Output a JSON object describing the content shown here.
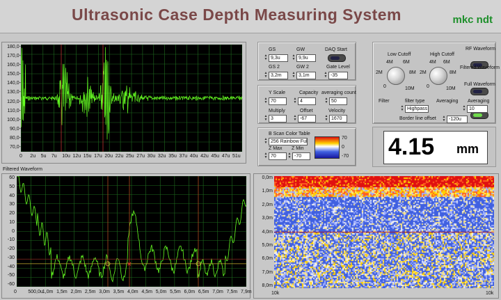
{
  "title": "Ultrasonic Case Depth Measuring System",
  "brand": "mkc ndt",
  "rf_graph": {
    "yticks": [
      "180,0-",
      "170,0-",
      "160,0-",
      "150,0-",
      "140,0-",
      "130,0-",
      "120,0-",
      "110,0-",
      "100,0-",
      "90,0-",
      "80,0-",
      "70,0-"
    ],
    "xticks": [
      "0",
      "2u",
      "5u",
      "7u",
      "10u",
      "12u",
      "15u",
      "17u",
      "20u",
      "22u",
      "25u",
      "27u",
      "30u",
      "32u",
      "35u",
      "37u",
      "40u",
      "42u",
      "45u",
      "47u",
      "51u"
    ]
  },
  "filtered_graph": {
    "label": "Filtered Waveform",
    "yticks": [
      "60",
      "50",
      "40",
      "30",
      "20",
      "10",
      "0",
      "-10",
      "-20",
      "-30",
      "-40",
      "-50",
      "-60"
    ],
    "xticks": [
      "0",
      "500,0u",
      "1,0m",
      "1,5m",
      "2,0m",
      "2,5m",
      "3,0m",
      "3,5m",
      "4,0m",
      "4,5m",
      "5,0m",
      "5,5m",
      "6,0m",
      "6,5m",
      "7,0m",
      "7,5m",
      "7,9m"
    ]
  },
  "bscan": {
    "yticks": [
      "0,0m",
      "1,0m",
      "2,0m",
      "3,0m",
      "4,0m",
      "5,0m",
      "6,0m",
      "7,0m",
      "8,0m"
    ],
    "xticks": [
      "10k",
      "10k"
    ]
  },
  "gates": {
    "gs_label": "GS",
    "gs_value": "9,3u",
    "gw_label": "GW",
    "gw_value": "9,9u",
    "daq_label": "DAQ Start",
    "gs2_label": "GS 2",
    "gs2_value": "3,2m",
    "gw2_label": "GW 2",
    "gw2_value": "3,1m",
    "gate_level_label": "Gate Level",
    "gate_level_value": "-35"
  },
  "scale": {
    "yscale_label": "Y Scale",
    "yscale_value": "70",
    "capacity_label": "Capacity",
    "capacity_value": "4",
    "avg_label": "averaging count",
    "avg_value": "50",
    "multiply_label": "Multiply",
    "multiply_value": "3",
    "offset_label": "Offset",
    "offset_value": "-67",
    "velocity_label": "Velocity",
    "velocity_value": "1670"
  },
  "colortable": {
    "label": "B Scan Color Table",
    "value": "256 Rainbow Full",
    "zmax_label": "Z Max",
    "zmax_value": "70",
    "zmin_label": "Z Min",
    "zmin_value": "-70",
    "ramp_ticks": [
      "70",
      "0",
      "-70"
    ]
  },
  "filters": {
    "low_label": "Low Cutoff",
    "high_label": "High Cutoff",
    "low_marks": [
      "4M",
      "6M",
      "2M",
      "8M",
      "0",
      "10M"
    ],
    "high_marks": [
      "4M",
      "6M",
      "2M",
      "8M",
      "0",
      "10M"
    ],
    "rf_label": "RF Waveform",
    "filtered_label": "Filtered Waveform",
    "full_label": "Full Waveform",
    "filter_label": "Filter",
    "filter_type_label": "filter type",
    "filter_type_value": "Highpass",
    "averaging_label": "Averaging",
    "averaging2_label": "Averaging",
    "averaging2_value": "10",
    "border_label": "Border line offset",
    "border_value": "-120u"
  },
  "readout": {
    "value": "4.15",
    "unit": "mm"
  },
  "colors": {
    "waveform": "#66ff22",
    "title": "#7a4848",
    "brand": "#1d8f2a"
  }
}
